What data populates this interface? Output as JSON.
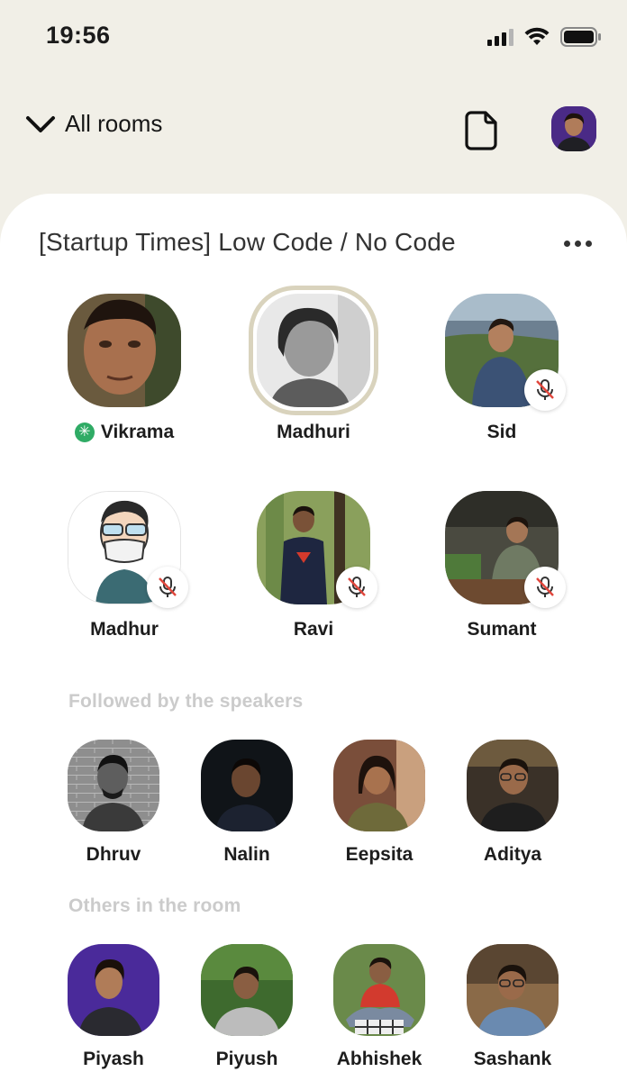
{
  "status_bar": {
    "time": "19:56"
  },
  "nav": {
    "back_label": "All rooms"
  },
  "room": {
    "title": "[Startup Times] Low Code / No Code",
    "speakers": [
      {
        "name": "Vikrama",
        "moderator": true,
        "muted": false,
        "speaking": false
      },
      {
        "name": "Madhuri",
        "moderator": false,
        "muted": false,
        "speaking": true
      },
      {
        "name": "Sid",
        "moderator": false,
        "muted": true,
        "speaking": false
      },
      {
        "name": "Madhur",
        "moderator": false,
        "muted": true,
        "speaking": false
      },
      {
        "name": "Ravi",
        "moderator": false,
        "muted": true,
        "speaking": false
      },
      {
        "name": "Sumant",
        "moderator": false,
        "muted": true,
        "speaking": false
      }
    ],
    "followed_label": "Followed by the speakers",
    "followed": [
      {
        "name": "Dhruv"
      },
      {
        "name": "Nalin"
      },
      {
        "name": "Eepsita"
      },
      {
        "name": "Aditya"
      }
    ],
    "others_label": "Others in the room",
    "others": [
      {
        "name": "Piyash"
      },
      {
        "name": "Piyush"
      },
      {
        "name": "Abhishek"
      },
      {
        "name": "Sashank"
      }
    ]
  },
  "icons": {
    "chevron": "chevron-down-icon",
    "document": "document-icon",
    "more": "more-icon",
    "mute": "mic-muted-icon",
    "moderator": "moderator-star-icon"
  },
  "colors": {
    "background": "#f1efe7",
    "card": "#ffffff",
    "moderator": "#2fab65",
    "mute": "#e0463c"
  }
}
